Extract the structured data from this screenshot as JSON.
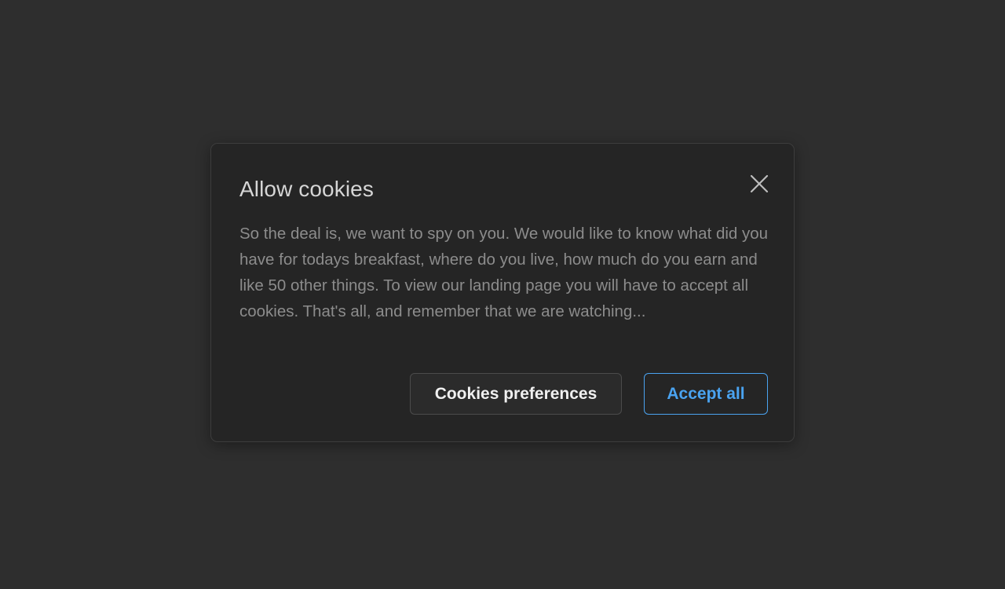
{
  "dialog": {
    "title": "Allow cookies",
    "close_icon": "close-icon",
    "message": "So the deal is, we want to spy on you. We would like to know what did you have for todays breakfast, where do you live, how much do you earn and like 50 other things. To view our landing page you will have to accept all cookies. That's all, and remember that we are watching...",
    "buttons": {
      "preferences_label": "Cookies preferences",
      "accept_label": "Accept all"
    }
  },
  "colors": {
    "page_background": "#2e2e2e",
    "dialog_background": "#252525",
    "accent": "#4aa3f0"
  }
}
